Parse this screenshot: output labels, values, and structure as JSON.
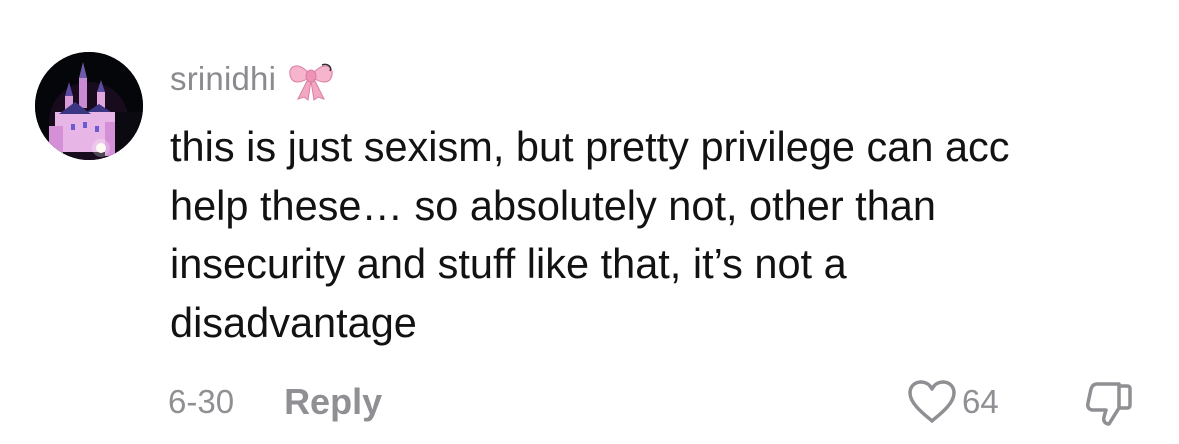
{
  "comment": {
    "username": "srinidhi",
    "username_emoji": "bow-emoji",
    "avatar_icon": "castle-night-avatar",
    "text": "this is just sexism, but pretty privilege can acc\nhelp these… so absolutely not, other than\ninsecurity and stuff like that, it’s not a\ndisadvantage",
    "date": "6-30",
    "reply_label": "Reply",
    "like_count": "64",
    "like_icon": "heart-outline-icon",
    "dislike_icon": "thumbs-down-icon"
  },
  "colors": {
    "meta_gray": "#8f8f94",
    "text": "#121212",
    "bow_pink": "#f4a7c3"
  }
}
